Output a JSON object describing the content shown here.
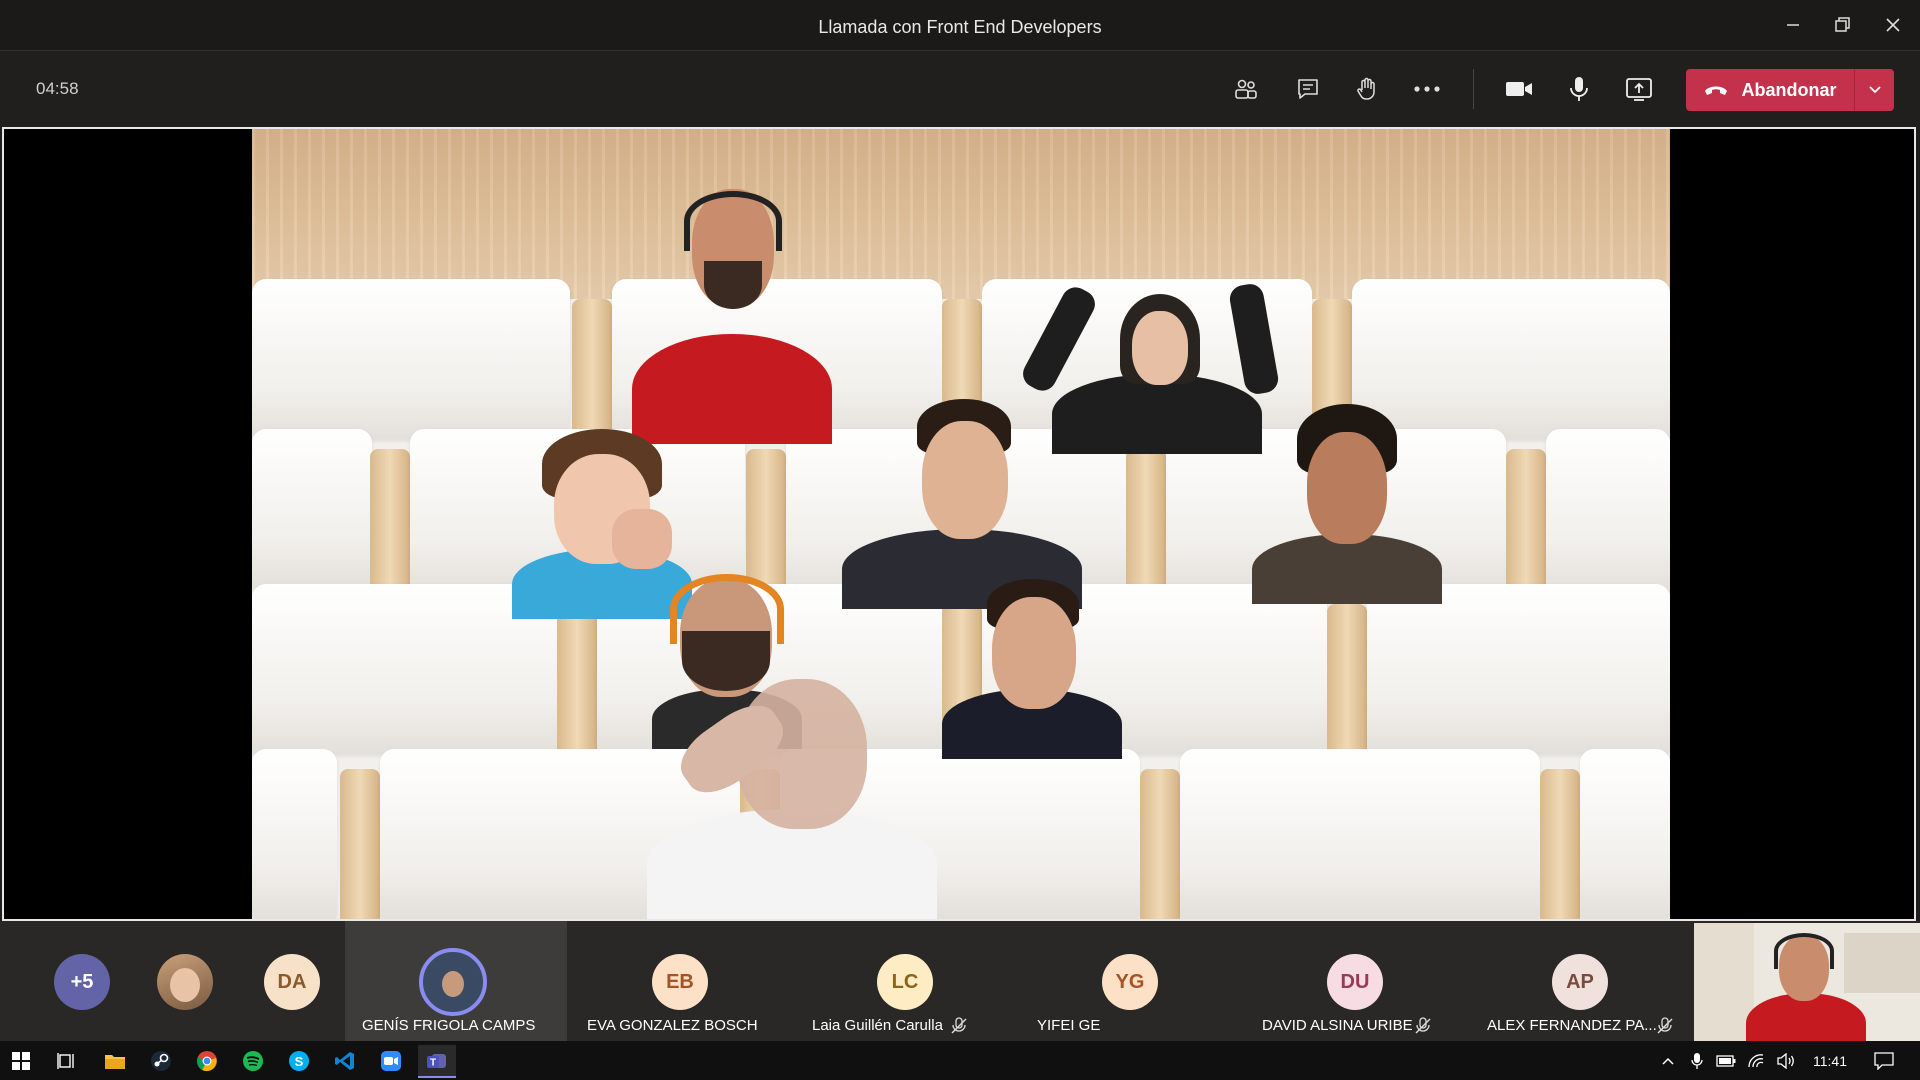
{
  "window": {
    "title": "Llamada con Front End Developers"
  },
  "toolbar": {
    "timer": "04:58",
    "leave_label": "Abandonar",
    "icons": [
      "people-icon",
      "chat-icon",
      "raise-hand-icon",
      "more-options-icon",
      "camera-icon",
      "microphone-icon",
      "share-screen-icon"
    ]
  },
  "participants": {
    "overflow": "+5",
    "items": [
      {
        "initials": "DA",
        "name": "",
        "bg": "#f8e1c9",
        "fg": "#8a5a2b"
      },
      {
        "initials": "",
        "name": "GENÍS FRIGOLA CAMPS",
        "bg": "#3b4a63",
        "fg": "#ffffff",
        "ring": "#8b8cf0"
      },
      {
        "initials": "EB",
        "name": "EVA GONZALEZ BOSCH",
        "bg": "#fde1c6",
        "fg": "#a5542a"
      },
      {
        "initials": "LC",
        "name": "Laia Guillén Carulla",
        "bg": "#fdecc4",
        "fg": "#8a6417",
        "muted": true
      },
      {
        "initials": "YG",
        "name": "YIFEI GE",
        "bg": "#fde1c6",
        "fg": "#a5542a"
      },
      {
        "initials": "DU",
        "name": "DAVID ALSINA URIBE",
        "bg": "#f7dce3",
        "fg": "#9a3a55",
        "muted": true
      },
      {
        "initials": "AP",
        "name": "ALEX FERNANDEZ PA...",
        "bg": "#f1e1dc",
        "fg": "#7a4c3f",
        "muted": true
      }
    ]
  },
  "taskbar": {
    "time": "11:41"
  },
  "colors": {
    "accent": "#c4314b",
    "teams": "#6264a7"
  }
}
